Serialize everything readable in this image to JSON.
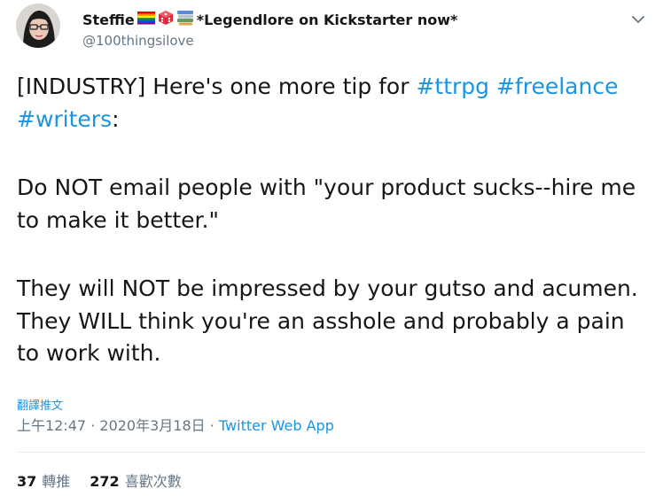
{
  "author": {
    "display_name": "Steffie",
    "name_suffix": "*Legendlore on Kickstarter now*",
    "handle": "@100thingsilove",
    "emoji": [
      "rainbow-flag",
      "game-die",
      "books"
    ]
  },
  "tweet": {
    "paragraphs": [
      [
        {
          "type": "text",
          "value": "[INDUSTRY] Here's one more tip for "
        },
        {
          "type": "hashtag",
          "value": "#ttrpg"
        },
        {
          "type": "text",
          "value": " "
        },
        {
          "type": "hashtag",
          "value": "#freelance"
        },
        {
          "type": "text",
          "value": " "
        },
        {
          "type": "hashtag",
          "value": "#writers"
        },
        {
          "type": "text",
          "value": ":"
        }
      ],
      [
        {
          "type": "text",
          "value": "Do NOT email people with \"your product sucks--hire me to make it better.\""
        }
      ],
      [
        {
          "type": "text",
          "value": "They will NOT be impressed by your gutso and acumen. They WILL think you're an asshole and probably a pain to work with."
        }
      ]
    ],
    "translate_label": "翻譯推文",
    "time": "上午12:47",
    "separator": " · ",
    "date": "2020年3月18日",
    "source": "Twitter Web App"
  },
  "stats": {
    "retweets_count": "37",
    "retweets_label": "轉推",
    "likes_count": "272",
    "likes_label": "喜歡次數"
  },
  "colors": {
    "link": "#1b95e0",
    "secondary": "#657786",
    "text": "#14171a"
  }
}
